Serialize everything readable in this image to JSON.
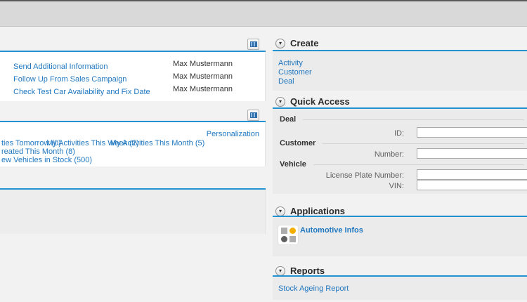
{
  "icons": {
    "collapse_chevron": "▾"
  },
  "colors": {
    "accent_blue": "#2492d1",
    "link_blue": "#1f77c0",
    "tile_orange": "#f5af00",
    "top_band": "#d9d9d9"
  },
  "left_column": {
    "tasks_panel": {
      "rows": [
        {
          "link": "Send Additional Information",
          "owner": "Max Mustermann"
        },
        {
          "link": "Follow Up From Sales Campaign",
          "owner": "Max Mustermann"
        },
        {
          "link": "Check Test Car Availability and Fix Date",
          "owner": "Max Mustermann"
        }
      ]
    },
    "activities_panel": {
      "personalization_link": "Personalization",
      "links_row1": [
        {
          "label": "ties Tomorrow (0)"
        },
        {
          "label": "My Activities This Week (2)"
        },
        {
          "label": "My Activities This Month (5)"
        }
      ],
      "links_row2": {
        "label": "reated This Month (8)"
      },
      "links_row3": {
        "label": "ew Vehicles in Stock (500)"
      }
    }
  },
  "right_column": {
    "create_section": {
      "title": "Create",
      "links": [
        {
          "label": "Activity"
        },
        {
          "label": "Customer"
        },
        {
          "label": "Deal"
        }
      ]
    },
    "quick_access_section": {
      "title": "Quick Access",
      "groups": [
        {
          "name": "Deal",
          "fields": [
            {
              "label": "ID:",
              "value": ""
            }
          ]
        },
        {
          "name": "Customer",
          "fields": [
            {
              "label": "Number:",
              "value": ""
            }
          ]
        },
        {
          "name": "Vehicle",
          "fields": [
            {
              "label": "License Plate Number:",
              "value": ""
            },
            {
              "label": "VIN:",
              "value": ""
            }
          ]
        }
      ]
    },
    "applications_section": {
      "title": "Applications",
      "apps": [
        {
          "label": "Automotive Infos"
        }
      ]
    },
    "reports_section": {
      "title": "Reports",
      "links": [
        {
          "label": "Stock Ageing Report"
        }
      ]
    }
  }
}
